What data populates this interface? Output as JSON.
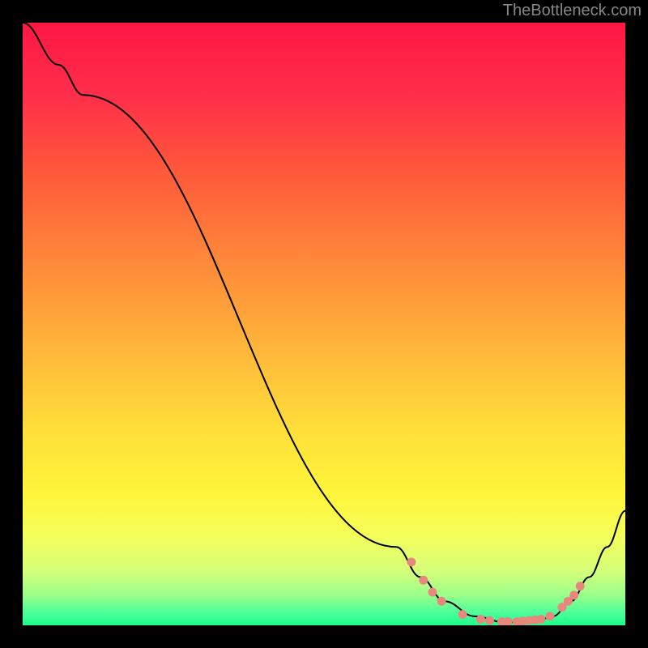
{
  "watermark": "TheBottleneck.com",
  "chart_data": {
    "type": "line",
    "title": "",
    "xlabel": "",
    "ylabel": "",
    "xlim": [
      0,
      100
    ],
    "ylim": [
      0,
      100
    ],
    "gradient_stops": [
      {
        "offset": 0,
        "color": "#ff1744"
      },
      {
        "offset": 12,
        "color": "#ff2e4a"
      },
      {
        "offset": 25,
        "color": "#ff5a3a"
      },
      {
        "offset": 40,
        "color": "#ff8a3a"
      },
      {
        "offset": 55,
        "color": "#ffb93a"
      },
      {
        "offset": 68,
        "color": "#ffe03a"
      },
      {
        "offset": 78,
        "color": "#fff53a"
      },
      {
        "offset": 85,
        "color": "#f5ff5a"
      },
      {
        "offset": 91,
        "color": "#d5ff7a"
      },
      {
        "offset": 95,
        "color": "#9aff8a"
      },
      {
        "offset": 98,
        "color": "#4aff9a"
      },
      {
        "offset": 100,
        "color": "#1aff8a"
      }
    ],
    "series": [
      {
        "name": "bottleneck-curve",
        "points": [
          {
            "x": 0,
            "y": 100
          },
          {
            "x": 6,
            "y": 93
          },
          {
            "x": 10,
            "y": 88
          },
          {
            "x": 62,
            "y": 13
          },
          {
            "x": 66,
            "y": 8
          },
          {
            "x": 70,
            "y": 4
          },
          {
            "x": 75,
            "y": 1.5
          },
          {
            "x": 80,
            "y": 0.5
          },
          {
            "x": 85,
            "y": 0.5
          },
          {
            "x": 88,
            "y": 1.5
          },
          {
            "x": 91,
            "y": 4
          },
          {
            "x": 94,
            "y": 8
          },
          {
            "x": 97,
            "y": 13
          },
          {
            "x": 100,
            "y": 19
          }
        ]
      }
    ],
    "dots": [
      {
        "x": 64.5,
        "y": 10.5
      },
      {
        "x": 66.5,
        "y": 7.5
      },
      {
        "x": 68,
        "y": 5.5
      },
      {
        "x": 69.5,
        "y": 4
      },
      {
        "x": 73,
        "y": 1.8
      },
      {
        "x": 76,
        "y": 1
      },
      {
        "x": 77.5,
        "y": 0.8
      },
      {
        "x": 79.5,
        "y": 0.6
      },
      {
        "x": 80.5,
        "y": 0.6
      },
      {
        "x": 82,
        "y": 0.6
      },
      {
        "x": 83,
        "y": 0.7
      },
      {
        "x": 84,
        "y": 0.8
      },
      {
        "x": 85,
        "y": 0.9
      },
      {
        "x": 86,
        "y": 1
      },
      {
        "x": 87.5,
        "y": 1.5
      },
      {
        "x": 89.5,
        "y": 3
      },
      {
        "x": 90.5,
        "y": 4
      },
      {
        "x": 91.5,
        "y": 5
      },
      {
        "x": 92.5,
        "y": 6.5
      }
    ]
  }
}
